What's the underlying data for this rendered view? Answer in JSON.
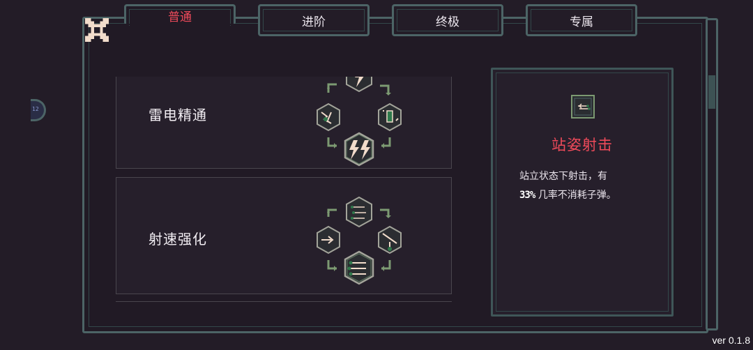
{
  "tabs": [
    {
      "label": "普通",
      "active": true
    },
    {
      "label": "进阶",
      "active": false
    },
    {
      "label": "终极",
      "active": false
    },
    {
      "label": "专属",
      "active": false
    }
  ],
  "close_icon": "close-x-icon",
  "side_handle_text": "12",
  "skills": [
    {
      "name": "雷电精通",
      "icon": "lightning-icon"
    },
    {
      "name": "射速强化",
      "icon": "rapid-fire-icon"
    }
  ],
  "detail": {
    "icon": "standing-shot-icon",
    "title": "站姿射击",
    "desc_line1": "站立状态下射击，有",
    "percent": "33%",
    "desc_line2": " 几率不消耗子弹。"
  },
  "version": "ver 0.1.8",
  "colors": {
    "background": "#231c27",
    "frame_border": "#4c6466",
    "accent_red": "#ef4a5a",
    "icon_cream": "#f2dccb",
    "arrow_green": "#7c9a72"
  }
}
